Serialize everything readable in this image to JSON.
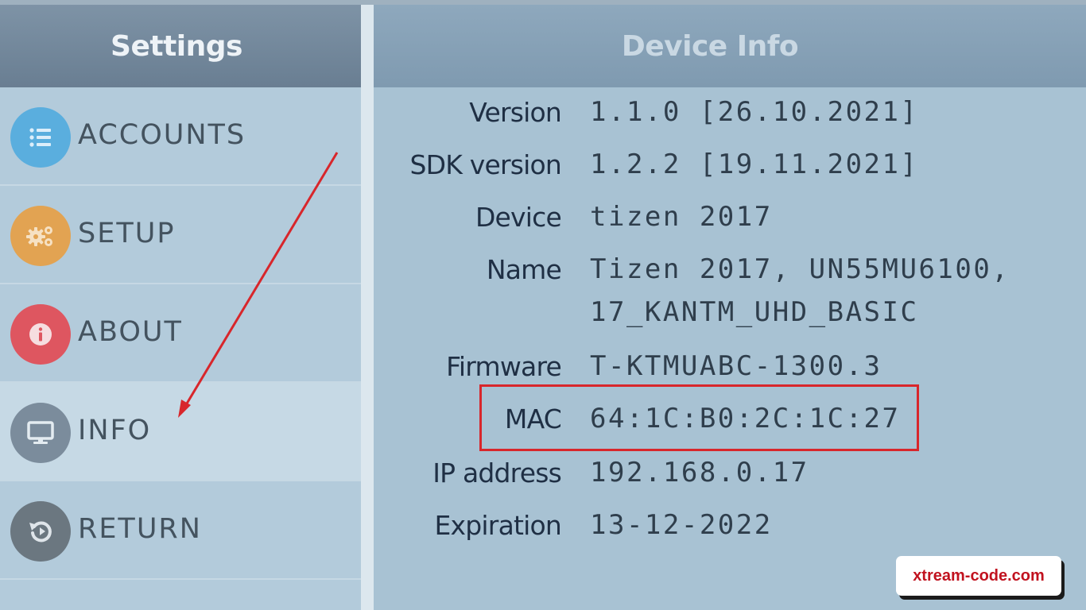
{
  "sidebar": {
    "title": "Settings",
    "items": [
      {
        "label": "ACCOUNTS",
        "icon": "list-icon",
        "color": "#5aaede"
      },
      {
        "label": "SETUP",
        "icon": "gears-icon",
        "color": "#e2a352"
      },
      {
        "label": "ABOUT",
        "icon": "info-icon",
        "color": "#de5660"
      },
      {
        "label": "INFO",
        "icon": "monitor-icon",
        "color": "#7b8c9c",
        "selected": true
      },
      {
        "label": "RETURN",
        "icon": "return-icon",
        "color": "#6b7780"
      }
    ]
  },
  "content": {
    "title": "Device Info",
    "rows": [
      {
        "label": "Version",
        "value": "1.1.0 [26.10.2021]"
      },
      {
        "label": "SDK version",
        "value": "1.2.2 [19.11.2021]"
      },
      {
        "label": "Device",
        "value": "tizen 2017"
      },
      {
        "label": "Name",
        "value": "Tizen 2017, UN55MU6100,",
        "value2": "17_KANTM_UHD_BASIC"
      },
      {
        "label": "Firmware",
        "value": "T-KTMUABC-1300.3"
      },
      {
        "label": "MAC",
        "value": "64:1C:B0:2C:1C:27"
      },
      {
        "label": "IP address",
        "value": "192.168.0.17"
      },
      {
        "label": "Expiration",
        "value": "13-12-2022"
      }
    ]
  },
  "annotations": {
    "highlight_color": "#d8262b",
    "arrow_color": "#d8262b"
  },
  "watermark": {
    "text": "xtream-code.com"
  }
}
